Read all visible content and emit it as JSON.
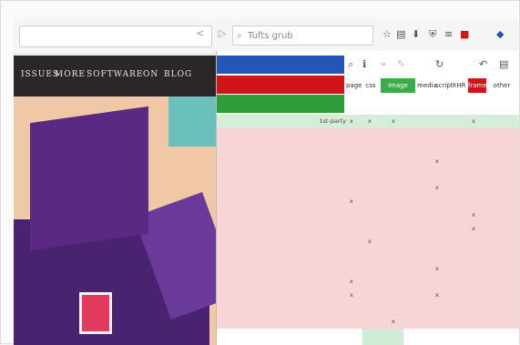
{
  "browser": {
    "search_text": "Tufts grub",
    "nav_glyphs": "< ▷ ↻",
    "toolbar_icons": [
      "star-icon",
      "reader-icon",
      "download-icon",
      "shield-icon",
      "menu-icon",
      "addon-red-icon",
      "addon-blue-icon"
    ]
  },
  "site": {
    "nav_items": [
      "ISSUES",
      "MORE",
      "SOFTWARE",
      "ON",
      "BLOG"
    ]
  },
  "panel": {
    "bars": {
      "blue_label": "",
      "red_label": "",
      "green_label": ""
    },
    "filters": [
      {
        "label": "page",
        "state": "normal"
      },
      {
        "label": "css",
        "state": "normal"
      },
      {
        "label": "image",
        "state": "active"
      },
      {
        "label": "media",
        "state": "normal"
      },
      {
        "label": "script",
        "state": "normal"
      },
      {
        "label": "XHR",
        "state": "normal"
      },
      {
        "label": "frame",
        "state": "alert"
      },
      {
        "label": "other",
        "state": "normal"
      }
    ],
    "rows": [
      {
        "name": "1st-party",
        "type": "green",
        "marks": [
          "x",
          "x",
          "x",
          "",
          "x"
        ]
      },
      {
        "name": "",
        "type": "red",
        "marks": [
          "",
          "",
          "",
          "",
          ""
        ]
      },
      {
        "name": "",
        "type": "red",
        "marks": [
          "",
          "",
          "",
          "",
          ""
        ]
      },
      {
        "name": "",
        "type": "red",
        "marks": [
          "",
          "",
          "",
          "x",
          ""
        ]
      },
      {
        "name": "",
        "type": "red",
        "marks": [
          "",
          "",
          "",
          "",
          ""
        ]
      },
      {
        "name": "",
        "type": "red",
        "marks": [
          "",
          "",
          "",
          "x",
          ""
        ]
      },
      {
        "name": "",
        "type": "red",
        "marks": [
          "x",
          "",
          "",
          "",
          ""
        ]
      },
      {
        "name": "",
        "type": "red",
        "marks": [
          "",
          "",
          "",
          "",
          "x"
        ]
      },
      {
        "name": "",
        "type": "red",
        "marks": [
          "",
          "",
          "",
          "",
          "x"
        ]
      },
      {
        "name": "",
        "type": "red",
        "marks": [
          "",
          "x",
          "",
          "",
          ""
        ]
      },
      {
        "name": "",
        "type": "red",
        "marks": [
          "",
          "",
          "",
          "",
          ""
        ]
      },
      {
        "name": "",
        "type": "red",
        "marks": [
          "",
          "",
          "",
          "x",
          ""
        ]
      },
      {
        "name": "",
        "type": "red",
        "marks": [
          "x",
          "",
          "",
          "",
          ""
        ]
      },
      {
        "name": "",
        "type": "red",
        "marks": [
          "x",
          "",
          "",
          "x",
          ""
        ]
      },
      {
        "name": "",
        "type": "red",
        "marks": [
          "",
          "",
          "",
          "",
          ""
        ]
      },
      {
        "name": "",
        "type": "red",
        "marks": [
          "",
          "",
          "x",
          "",
          ""
        ]
      }
    ]
  },
  "colors": {
    "blue": "#2456b5",
    "red": "#d0141a",
    "green": "#2e9c3a",
    "nav": "#2b2728"
  }
}
